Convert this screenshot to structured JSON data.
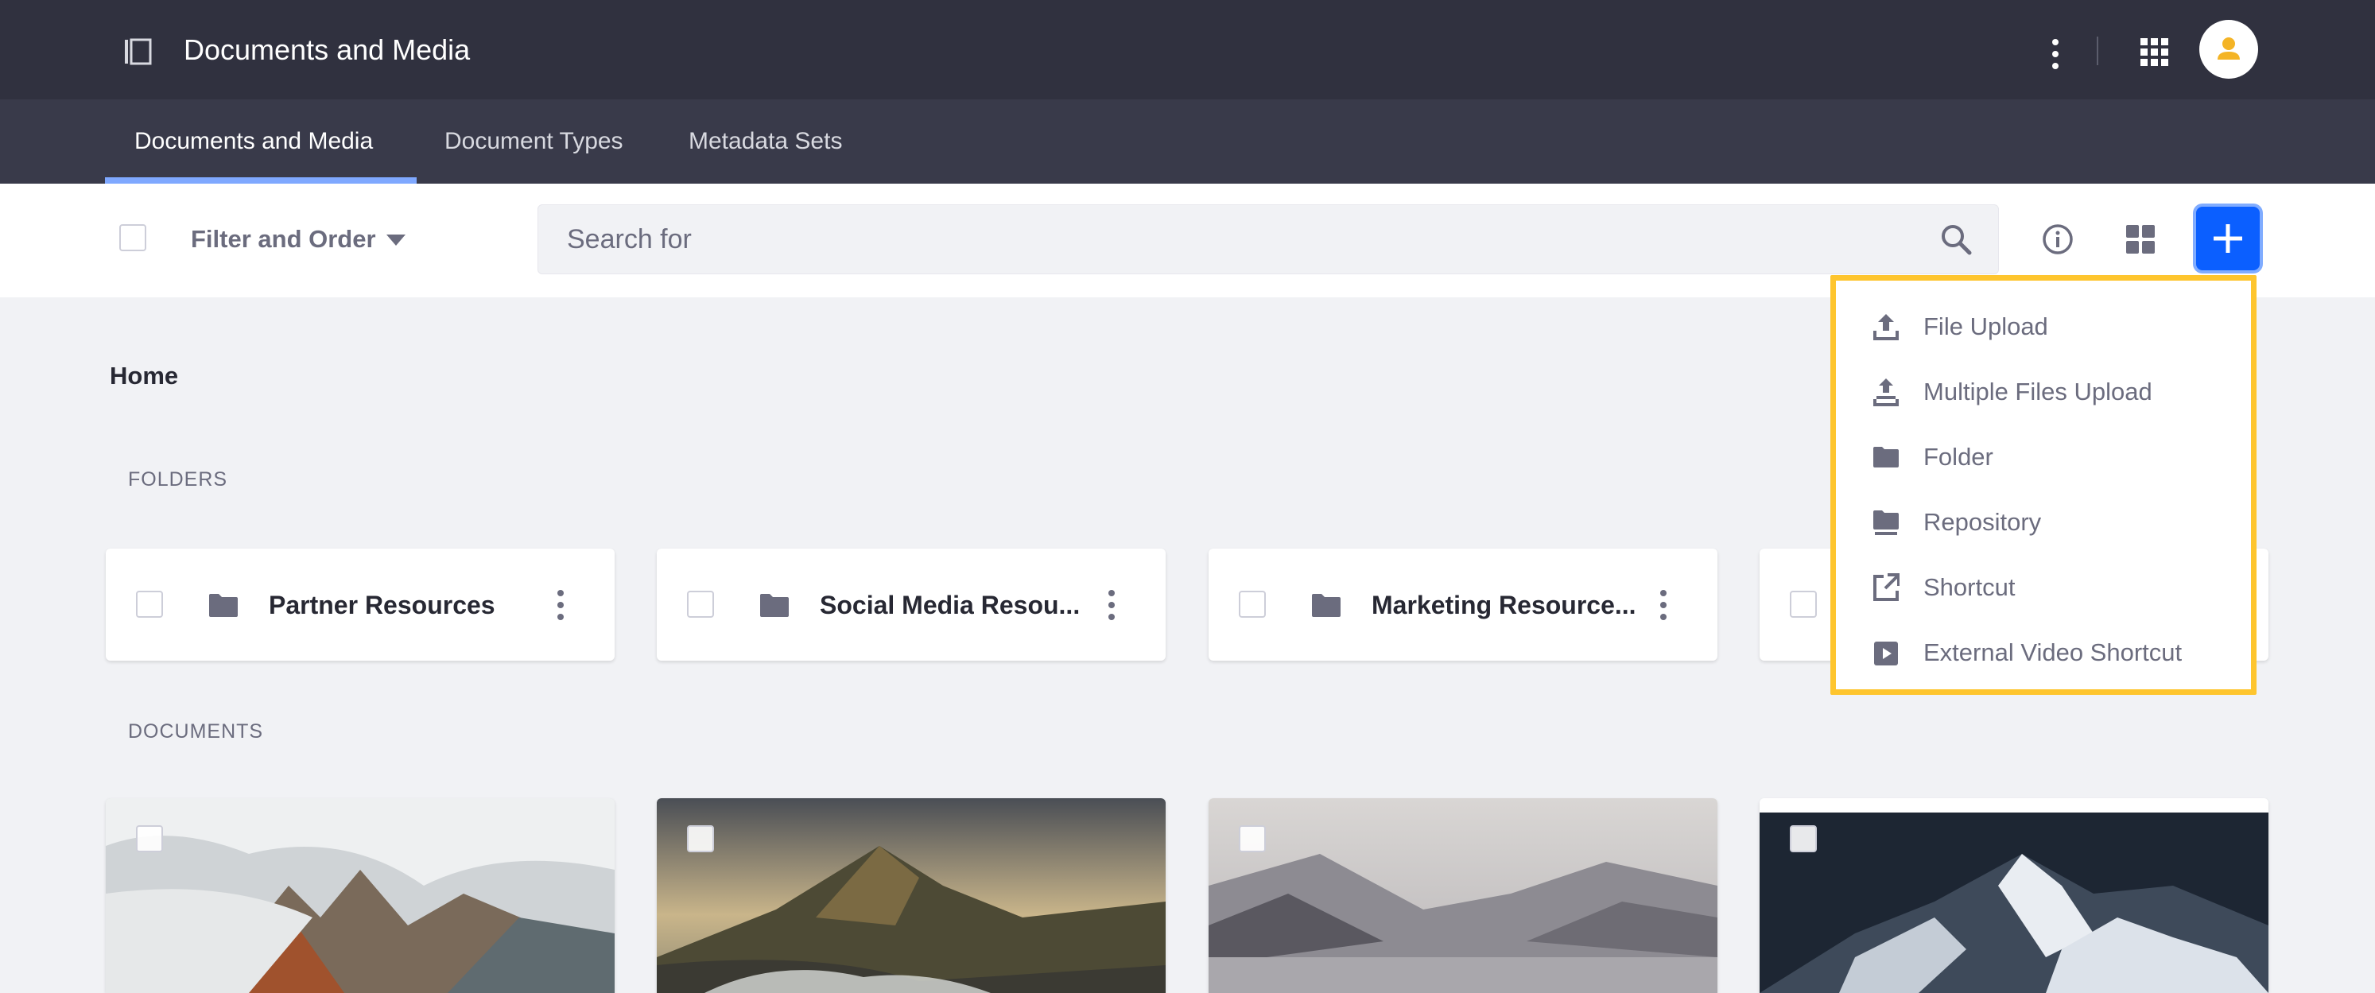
{
  "app": {
    "title": "Documents and Media"
  },
  "nav": {
    "tabs": [
      {
        "label": "Documents and Media",
        "active": true
      },
      {
        "label": "Document Types",
        "active": false
      },
      {
        "label": "Metadata Sets",
        "active": false
      }
    ]
  },
  "toolbar": {
    "filter_label": "Filter and Order",
    "search_placeholder": "Search for"
  },
  "breadcrumb": "Home",
  "sections": {
    "folders_title": "FOLDERS",
    "documents_title": "DOCUMENTS"
  },
  "folders": [
    {
      "name": "Partner Resources"
    },
    {
      "name": "Social Media Resou..."
    },
    {
      "name": "Marketing Resource..."
    }
  ],
  "add_menu": {
    "items": [
      {
        "label": "File Upload",
        "icon": "upload-icon"
      },
      {
        "label": "Multiple Files Upload",
        "icon": "multiple-upload-icon"
      },
      {
        "label": "Folder",
        "icon": "folder-icon"
      },
      {
        "label": "Repository",
        "icon": "repository-icon"
      },
      {
        "label": "Shortcut",
        "icon": "shortcut-icon"
      },
      {
        "label": "External Video Shortcut",
        "icon": "video-icon"
      }
    ]
  },
  "colors": {
    "topbar": "#30313f",
    "navbar": "#393a4a",
    "primary": "#0b5fff",
    "highlight": "#fec52e"
  }
}
